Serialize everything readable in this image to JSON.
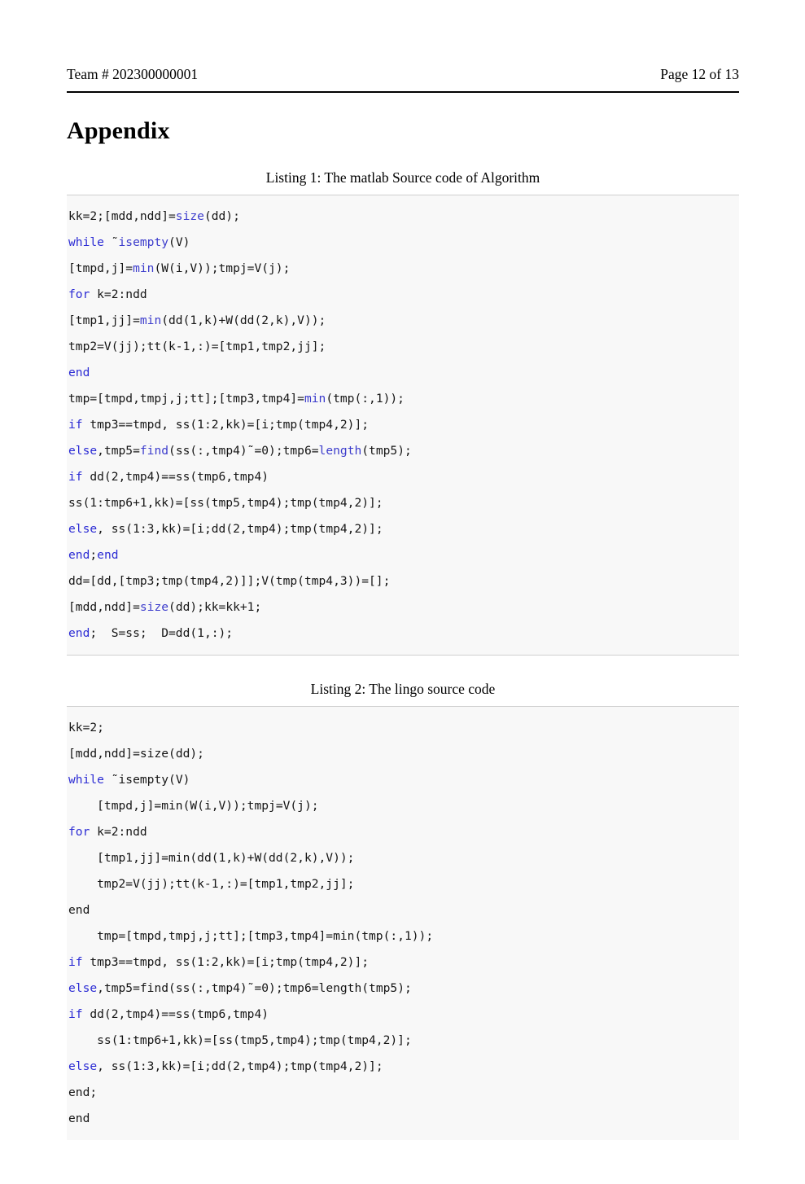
{
  "header": {
    "left": "Team # 202300000001",
    "right": "Page 12 of 13"
  },
  "section": {
    "title": "Appendix"
  },
  "colors": {
    "keyword": "#2b2bd4",
    "function": "#3c3ccc",
    "plain": "#151515",
    "listing_background": "#f8f8f8",
    "listing_rule": "#cfcfcf",
    "header_rule": "#000000"
  },
  "listings": [
    {
      "caption": "Listing 1:  The matlab Source code of Algorithm",
      "closed": true,
      "lines": [
        [
          {
            "t": "kk=2;[mdd,ndd]=",
            "c": "pl"
          },
          {
            "t": "size",
            "c": "fn"
          },
          {
            "t": "(dd);",
            "c": "pl"
          }
        ],
        [
          {
            "t": "while",
            "c": "kw"
          },
          {
            "t": " ˜",
            "c": "pl"
          },
          {
            "t": "isempty",
            "c": "fn"
          },
          {
            "t": "(V)",
            "c": "pl"
          }
        ],
        [
          {
            "t": "[tmpd,j]=",
            "c": "pl"
          },
          {
            "t": "min",
            "c": "fn"
          },
          {
            "t": "(W(i,V));tmpj=V(j);",
            "c": "pl"
          }
        ],
        [
          {
            "t": "for",
            "c": "kw"
          },
          {
            "t": " k=2:ndd",
            "c": "pl"
          }
        ],
        [
          {
            "t": "[tmp1,jj]=",
            "c": "pl"
          },
          {
            "t": "min",
            "c": "fn"
          },
          {
            "t": "(dd(1,k)+W(dd(2,k),V));",
            "c": "pl"
          }
        ],
        [
          {
            "t": "tmp2=V(jj);tt(k-1,:)=[tmp1,tmp2,jj];",
            "c": "pl"
          }
        ],
        [
          {
            "t": "end",
            "c": "kw"
          }
        ],
        [
          {
            "t": "tmp=[tmpd,tmpj,j;tt];[tmp3,tmp4]=",
            "c": "pl"
          },
          {
            "t": "min",
            "c": "fn"
          },
          {
            "t": "(tmp(:,1));",
            "c": "pl"
          }
        ],
        [
          {
            "t": "if",
            "c": "kw"
          },
          {
            "t": " tmp3==tmpd, ss(1:2,kk)=[i;tmp(tmp4,2)];",
            "c": "pl"
          }
        ],
        [
          {
            "t": "else",
            "c": "kw"
          },
          {
            "t": ",tmp5=",
            "c": "pl"
          },
          {
            "t": "find",
            "c": "fn"
          },
          {
            "t": "(ss(:,tmp4)˜=0);tmp6=",
            "c": "pl"
          },
          {
            "t": "length",
            "c": "fn"
          },
          {
            "t": "(tmp5);",
            "c": "pl"
          }
        ],
        [
          {
            "t": "if",
            "c": "kw"
          },
          {
            "t": " dd(2,tmp4)==ss(tmp6,tmp4)",
            "c": "pl"
          }
        ],
        [
          {
            "t": "ss(1:tmp6+1,kk)=[ss(tmp5,tmp4);tmp(tmp4,2)];",
            "c": "pl"
          }
        ],
        [
          {
            "t": "else",
            "c": "kw"
          },
          {
            "t": ", ss(1:3,kk)=[i;dd(2,tmp4);tmp(tmp4,2)];",
            "c": "pl"
          }
        ],
        [
          {
            "t": "end",
            "c": "kw"
          },
          {
            "t": ";",
            "c": "pl"
          },
          {
            "t": "end",
            "c": "kw"
          }
        ],
        [
          {
            "t": "dd=[dd,[tmp3;tmp(tmp4,2)]];V(tmp(tmp4,3))=[];",
            "c": "pl"
          }
        ],
        [
          {
            "t": "[mdd,ndd]=",
            "c": "pl"
          },
          {
            "t": "size",
            "c": "fn"
          },
          {
            "t": "(dd);kk=kk+1;",
            "c": "pl"
          }
        ],
        [
          {
            "t": "end",
            "c": "kw"
          },
          {
            "t": ";  S=ss;  D=dd(1,:);",
            "c": "pl"
          }
        ]
      ]
    },
    {
      "caption": "Listing 2:  The lingo source code",
      "closed": false,
      "lines": [
        [
          {
            "t": "kk=2;",
            "c": "pl"
          }
        ],
        [
          {
            "t": "[mdd,ndd]=",
            "c": "pl"
          },
          {
            "t": "size",
            "c": "fn"
          },
          {
            "t": "(dd);",
            "c": "pl"
          }
        ],
        [
          {
            "t": "while",
            "c": "kw"
          },
          {
            "t": " ˜",
            "c": "pl"
          },
          {
            "t": "isempty",
            "c": "fn"
          },
          {
            "t": "(V)",
            "c": "pl"
          }
        ],
        [
          {
            "t": "    [tmpd,j]=",
            "c": "pl"
          },
          {
            "t": "min",
            "c": "fn"
          },
          {
            "t": "(W(i,V));tmpj=V(j);",
            "c": "pl"
          }
        ],
        [
          {
            "t": "for",
            "c": "kw"
          },
          {
            "t": " k=2:ndd",
            "c": "pl"
          }
        ],
        [
          {
            "t": "    [tmp1,jj]=",
            "c": "pl"
          },
          {
            "t": "min",
            "c": "fn"
          },
          {
            "t": "(dd(1,k)+W(dd(2,k),V));",
            "c": "pl"
          }
        ],
        [
          {
            "t": "    tmp2=V(jj);tt(k-1,:)=[tmp1,tmp2,jj];",
            "c": "pl"
          }
        ],
        [
          {
            "t": "end",
            "c": "pl"
          }
        ],
        [
          {
            "t": "    tmp=[tmpd,tmpj,j;tt];[tmp3,tmp4]=",
            "c": "pl"
          },
          {
            "t": "min",
            "c": "fn"
          },
          {
            "t": "(tmp(:,1));",
            "c": "pl"
          }
        ],
        [
          {
            "t": "if",
            "c": "kw"
          },
          {
            "t": " tmp3==tmpd, ss(1:2,kk)=[i;tmp(tmp4,2)];",
            "c": "pl"
          }
        ],
        [
          {
            "t": "else",
            "c": "kw"
          },
          {
            "t": ",tmp5=",
            "c": "pl"
          },
          {
            "t": "find",
            "c": "fn"
          },
          {
            "t": "(ss(:,tmp4)˜=0);tmp6=",
            "c": "pl"
          },
          {
            "t": "length",
            "c": "fn"
          },
          {
            "t": "(tmp5);",
            "c": "pl"
          }
        ],
        [
          {
            "t": "if",
            "c": "kw"
          },
          {
            "t": " dd(2,tmp4)==ss(tmp6,tmp4)",
            "c": "pl"
          }
        ],
        [
          {
            "t": "    ss(1:tmp6+1,kk)=[ss(tmp5,tmp4);tmp(tmp4,2)];",
            "c": "pl"
          }
        ],
        [
          {
            "t": "else",
            "c": "kw"
          },
          {
            "t": ", ss(1:3,kk)=[i;dd(2,tmp4);tmp(tmp4,2)];",
            "c": "pl"
          }
        ],
        [
          {
            "t": "end;",
            "c": "pl"
          }
        ],
        [
          {
            "t": "end",
            "c": "pl"
          }
        ]
      ]
    }
  ]
}
